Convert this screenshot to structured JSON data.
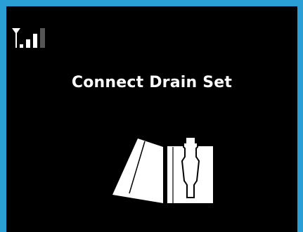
{
  "status_bar": {
    "signal_icon": "signal-strength-icon",
    "signal_level": 3,
    "signal_max": 4
  },
  "main": {
    "title": "Connect Drain Set",
    "illustration_icon": "drain-set-connection-icon"
  },
  "colors": {
    "frame": "#2a9fd6",
    "screen": "#000000",
    "foreground": "#ffffff",
    "inactive_bar": "#555555"
  }
}
